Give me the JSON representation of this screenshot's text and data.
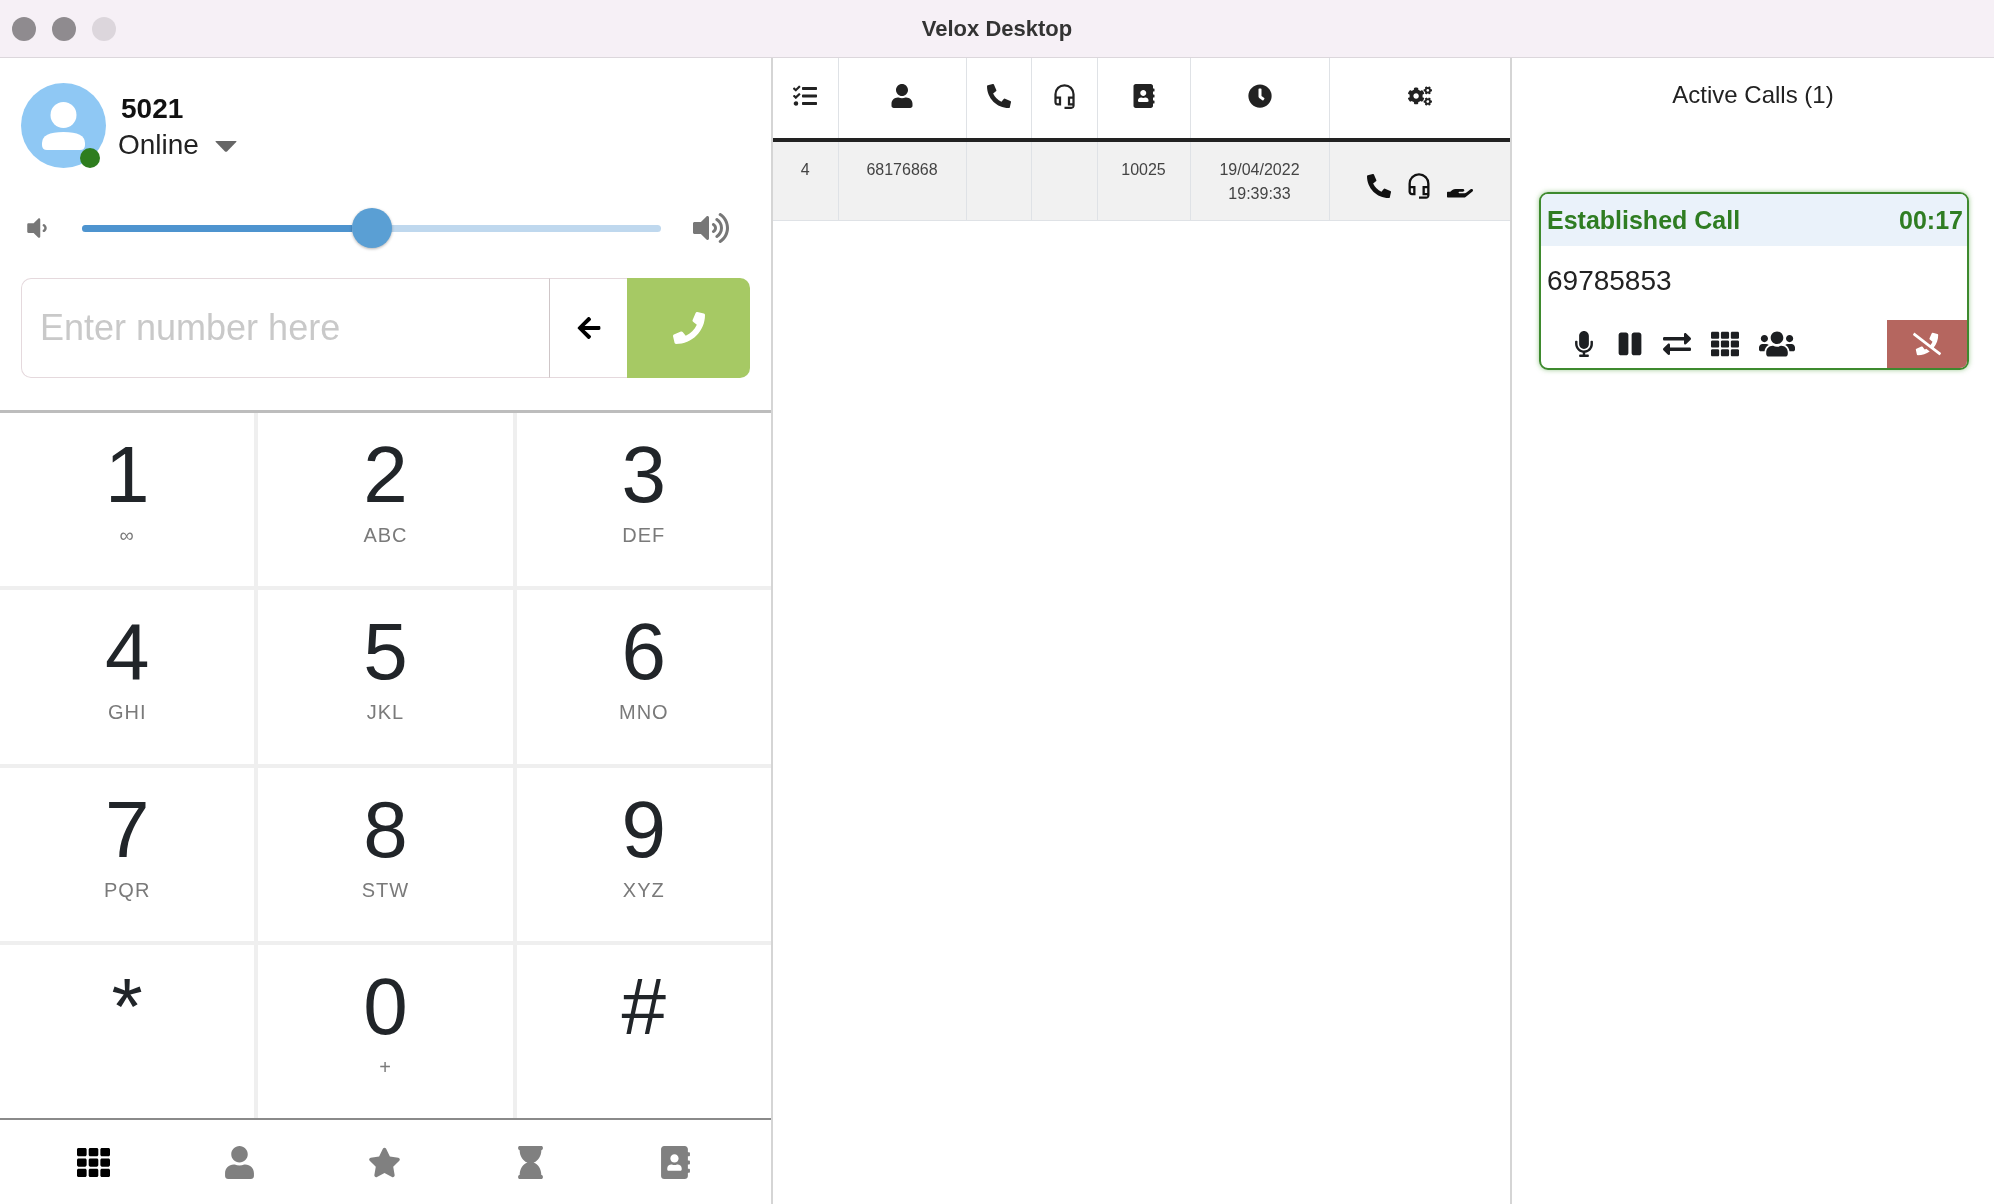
{
  "window": {
    "title": "Velox Desktop"
  },
  "profile": {
    "extension": "5021",
    "status": "Online"
  },
  "volume": {
    "level": 0.5
  },
  "dialer": {
    "placeholder": "Enter number here"
  },
  "keypad": [
    {
      "digit": "1",
      "letters": "∞"
    },
    {
      "digit": "2",
      "letters": "ABC"
    },
    {
      "digit": "3",
      "letters": "DEF"
    },
    {
      "digit": "4",
      "letters": "GHI"
    },
    {
      "digit": "5",
      "letters": "JKL"
    },
    {
      "digit": "6",
      "letters": "MNO"
    },
    {
      "digit": "7",
      "letters": "PQR"
    },
    {
      "digit": "8",
      "letters": "STW"
    },
    {
      "digit": "9",
      "letters": "XYZ"
    },
    {
      "digit": "*"
    },
    {
      "digit": "0",
      "letters": "+"
    },
    {
      "digit": "#"
    }
  ],
  "bottom_nav": [
    {
      "selected": true
    },
    {
      "selected": false
    },
    {
      "selected": false
    },
    {
      "selected": false
    },
    {
      "selected": false
    }
  ],
  "call_log": {
    "rows": [
      {
        "column_1": "4",
        "column_2": "68176868",
        "column_5": "10025",
        "column_6": "19/04/2022 19:39:33"
      }
    ]
  },
  "active_calls": {
    "title": "Active Calls (1)",
    "calls": [
      {
        "status": "Established Call",
        "duration": "00:17",
        "number": "69785853"
      }
    ]
  }
}
